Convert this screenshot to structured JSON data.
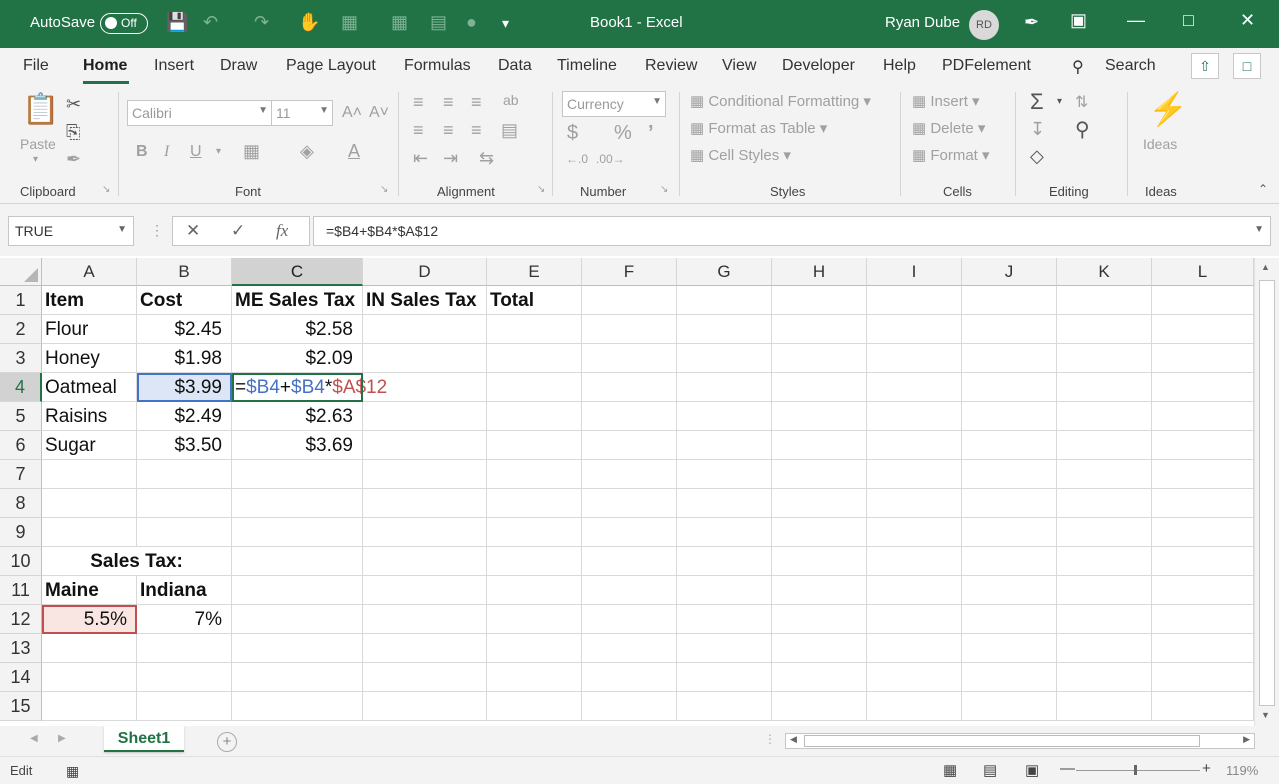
{
  "titlebar": {
    "autosave_label": "AutoSave",
    "autosave_state": "Off",
    "doc_title": "Book1  -  Excel",
    "user_name": "Ryan Dube",
    "user_initials": "RD"
  },
  "menu": {
    "tabs": [
      "File",
      "Home",
      "Insert",
      "Draw",
      "Page Layout",
      "Formulas",
      "Data",
      "Timeline",
      "Review",
      "View",
      "Developer",
      "Help",
      "PDFelement"
    ],
    "active": "Home",
    "search_label": "Search"
  },
  "ribbon": {
    "clipboard": {
      "paste": "Paste",
      "label": "Clipboard"
    },
    "font": {
      "family": "Calibri",
      "size": "11",
      "bold": "B",
      "italic": "I",
      "underline": "U",
      "grow": "A˄",
      "shrink": "A˅",
      "label": "Font"
    },
    "alignment": {
      "label": "Alignment"
    },
    "number": {
      "format": "Currency",
      "currency_symbol": "$",
      "percent": "%",
      "comma": "’",
      "label": "Number"
    },
    "styles": {
      "conditional": "Conditional Formatting",
      "table": "Format as Table",
      "cell_styles": "Cell Styles",
      "label": "Styles"
    },
    "cells": {
      "insert": "Insert",
      "delete": "Delete",
      "format": "Format",
      "label": "Cells"
    },
    "editing": {
      "label": "Editing"
    },
    "ideas": {
      "button": "Ideas",
      "label": "Ideas"
    }
  },
  "formula_bar": {
    "name_box": "TRUE",
    "formula": "=$B4+$B4*$A$12"
  },
  "sheet": {
    "columns": [
      "A",
      "B",
      "C",
      "D",
      "E",
      "F",
      "G",
      "H",
      "I",
      "J",
      "K",
      "L"
    ],
    "rows": [
      "1",
      "2",
      "3",
      "4",
      "5",
      "6",
      "7",
      "8",
      "9",
      "10",
      "11",
      "12",
      "13",
      "14",
      "15"
    ],
    "header": {
      "a1": "Item",
      "b1": "Cost",
      "c1": "ME Sales Tax",
      "d1": "IN Sales Tax",
      "e1": "Total"
    },
    "items": [
      {
        "name": "Flour",
        "cost": "$2.45",
        "me_tax": "$2.58"
      },
      {
        "name": "Honey",
        "cost": "$1.98",
        "me_tax": "$2.09"
      },
      {
        "name": "Oatmeal",
        "cost": "$3.99",
        "me_tax": ""
      },
      {
        "name": "Raisins",
        "cost": "$2.49",
        "me_tax": "$2.63"
      },
      {
        "name": "Sugar",
        "cost": "$3.50",
        "me_tax": "$3.69"
      }
    ],
    "formula_edit": {
      "eq": "=",
      "ref1": "$B4",
      "plus": "+",
      "ref2": "$B4",
      "times": "*",
      "ref3": "$A$12"
    },
    "tax_title": "Sales Tax:",
    "tax_headers": {
      "a11": "Maine",
      "b11": "Indiana"
    },
    "tax_values": {
      "a12": "5.5%",
      "b12": "7%"
    },
    "tab_name": "Sheet1"
  },
  "status": {
    "mode": "Edit",
    "zoom": "119%"
  },
  "colors": {
    "brand": "#217346",
    "ref_blue": "#4472c4",
    "ref_red": "#c0504d"
  }
}
